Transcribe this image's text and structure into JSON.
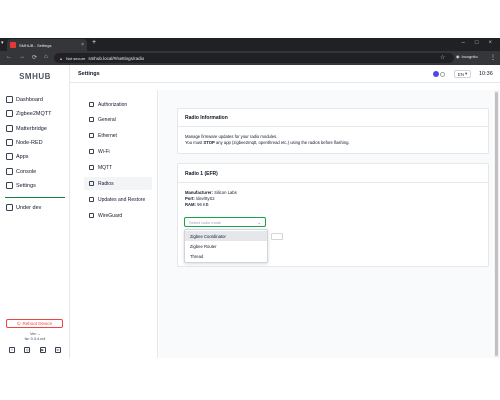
{
  "browser": {
    "tab_title": "SMHUB - Settings",
    "tab_close": "×",
    "new_tab": "+",
    "tab_menu": "▾",
    "not_secure_label": "Not secure",
    "url": "smhub.local/#/settings/radio",
    "incognito_label": "Incognito",
    "window_controls": [
      "–",
      "□",
      "×"
    ],
    "nav_icons": [
      "←",
      "→",
      "⟳",
      "⌂"
    ]
  },
  "sidebar": {
    "brand": "SMHUB",
    "items": [
      {
        "label": "Dashboard",
        "icon": "home-icon"
      },
      {
        "label": "Zigbee2MQTT",
        "icon": "zigbee-icon"
      },
      {
        "label": "Matterbridge",
        "icon": "matter-icon"
      },
      {
        "label": "Node-RED",
        "icon": "nodered-icon"
      },
      {
        "label": "Apps",
        "icon": "apps-icon"
      },
      {
        "label": "Console",
        "icon": "console-icon"
      },
      {
        "label": "Settings",
        "icon": "gear-icon"
      }
    ],
    "under_dev": "Under dev",
    "reboot_label": "Reboot Device",
    "fw_lines": [
      "Ver: –",
      "fw: 0.3.4.cr4"
    ],
    "social_icons": [
      "facebook-icon",
      "instagram-icon",
      "youtube-icon",
      "linkedin-icon"
    ]
  },
  "header": {
    "title": "Settings",
    "lang": "EN",
    "time": "10:36"
  },
  "settings_nav": [
    {
      "label": "Authorization",
      "icon": "lock-icon",
      "active": false
    },
    {
      "label": "General",
      "icon": "gear-icon",
      "active": false
    },
    {
      "label": "Ethernet",
      "icon": "ethernet-icon",
      "active": false
    },
    {
      "label": "Wi-Fi",
      "icon": "wifi-icon",
      "active": false
    },
    {
      "label": "MQTT",
      "icon": "mqtt-icon",
      "active": false
    },
    {
      "label": "Radios",
      "icon": "radio-icon",
      "active": true
    },
    {
      "label": "Updates and Restore",
      "icon": "update-icon",
      "active": false
    },
    {
      "label": "WireGuard",
      "icon": "wireguard-icon",
      "active": false
    }
  ],
  "radio_info": {
    "title": "Radio Information",
    "line1": "Manage firmware updates for your radio modules.",
    "line2_pre": "You must ",
    "line2_bold": "STOP",
    "line2_post": " any app (zigbee2mqtt, openthread etc.) using the radios before flashing."
  },
  "radio1": {
    "title": "Radio 1 (EFR)",
    "manufacturer_label": "Manufacturer:",
    "manufacturer": "Silicon Labs",
    "port_label": "Port:",
    "port": "/dev/ttyS2",
    "ram_label": "RAM:",
    "ram": "96 KB",
    "select_placeholder": "Select radio mode",
    "options": [
      "Zigbee Coordinator",
      "Zigbee Router",
      "Thread"
    ],
    "highlighted_option": "Zigbee Coordinator"
  },
  "colors": {
    "accent": "#16a34a",
    "danger": "#ef4444",
    "badge": "#4f46e5"
  }
}
